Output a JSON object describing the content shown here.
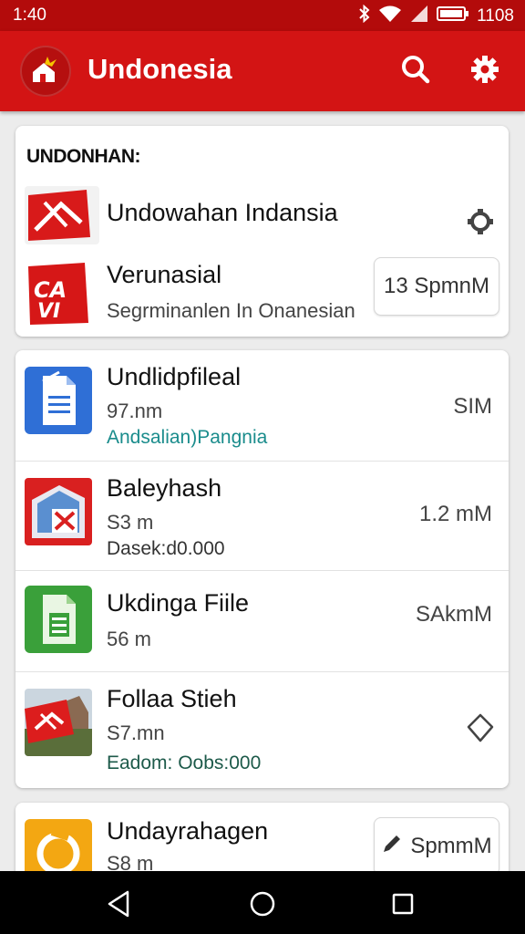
{
  "status": {
    "time": "1:40",
    "battery_time": "1108"
  },
  "appbar": {
    "title": "Undonesia"
  },
  "card1": {
    "heading": "UNDONHAN:",
    "items": [
      {
        "name": "Undowahan Indansia"
      },
      {
        "name": "Verunasial",
        "subtitle": "Segrminanlen In Onanesian",
        "pill": "13 SpmnM"
      }
    ]
  },
  "card2": {
    "items": [
      {
        "name": "Undlidpfileal",
        "line2": "97.nm",
        "line3": "Andsalian)Pangnia",
        "size": "SIM"
      },
      {
        "name": "Baleyhash",
        "line2": "S3 m",
        "line3": "Dasek:d0.000",
        "size": "1.2 mM"
      },
      {
        "name": "Ukdinga Fiile",
        "line2": "56 m",
        "size": "SAkmM"
      },
      {
        "name": "Follaa Stieh",
        "line2": "S7.mn",
        "line3": "Eadom: Oobs:000"
      }
    ]
  },
  "card3": {
    "items": [
      {
        "name": "Undayrahagen",
        "line2": "S8 m",
        "pill": "SpmmM"
      }
    ]
  }
}
